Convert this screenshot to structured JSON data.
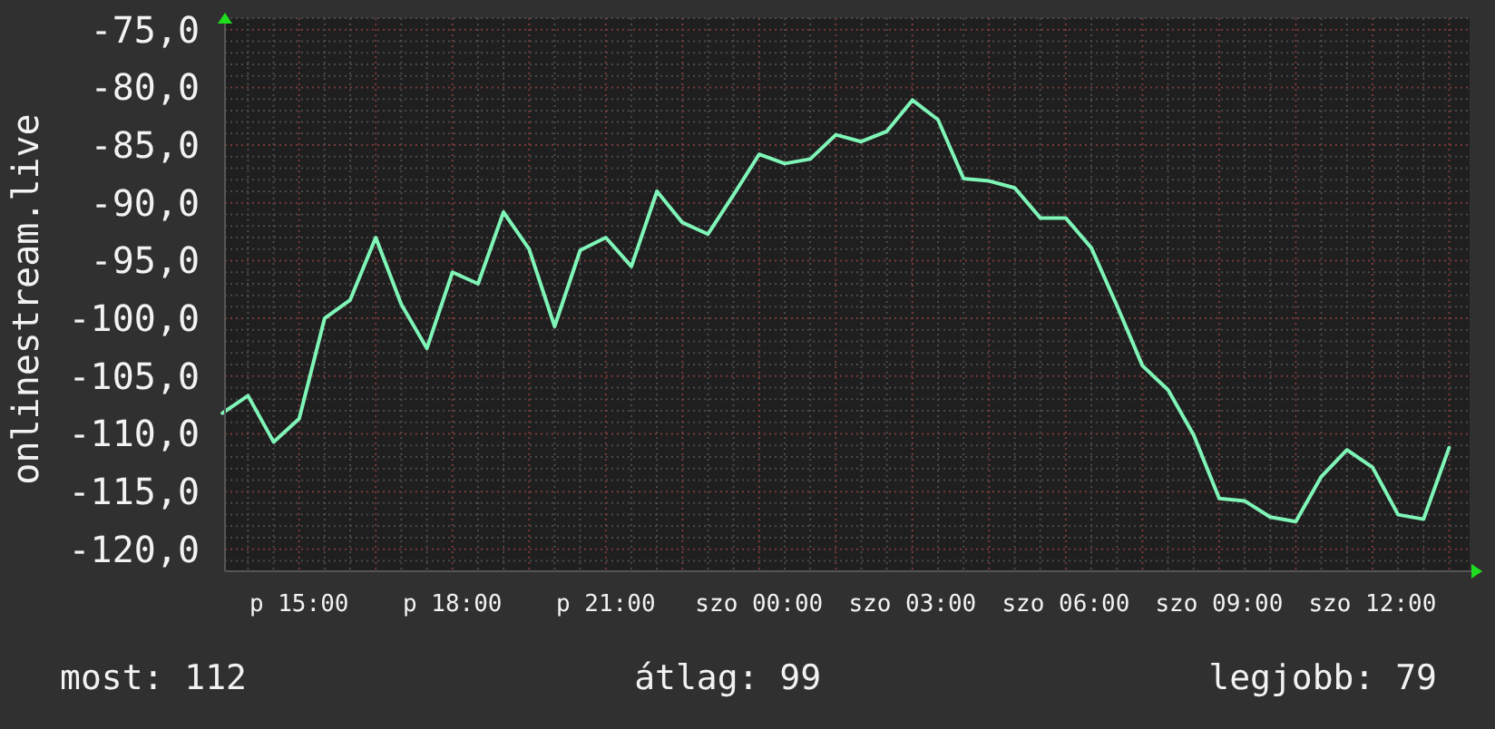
{
  "chart": {
    "chart_data": {
      "type": "line",
      "ylabel": "onlinestream.live",
      "categories": [
        null,
        null,
        null,
        "p 15:00",
        null,
        null,
        null,
        null,
        null,
        "p 18:00",
        null,
        null,
        null,
        null,
        null,
        "p 21:00",
        null,
        null,
        null,
        null,
        null,
        "szo 00:00",
        null,
        null,
        null,
        null,
        null,
        "szo 03:00",
        null,
        null,
        null,
        null,
        null,
        "szo 06:00",
        null,
        null,
        null,
        null,
        null,
        "szo 09:00",
        null,
        null,
        null,
        null,
        null,
        "szo 12:00",
        null,
        null,
        null
      ],
      "series": [
        {
          "color": "#7ff5b8",
          "values": [
            -108.2,
            -106.7,
            -110.7,
            -108.7,
            -100.0,
            -98.4,
            -93.0,
            -98.8,
            -102.6,
            -96.0,
            -97.0,
            -90.8,
            -94.0,
            -100.7,
            -94.1,
            -93.0,
            -95.5,
            -89.0,
            -91.7,
            -92.7,
            -89.3,
            -85.8,
            -86.6,
            -86.2,
            -84.1,
            -84.7,
            -83.8,
            -81.1,
            -82.8,
            -87.9,
            -88.1,
            -88.7,
            -91.3,
            -91.3,
            -93.9,
            -98.9,
            -104.1,
            -106.2,
            -110.1,
            -115.6,
            -115.8,
            -117.2,
            -117.6,
            -113.7,
            -111.4,
            -112.9,
            -117.0,
            -117.4,
            -111.2
          ]
        }
      ],
      "grid": true,
      "ylim": [
        -121.9,
        -74.0
      ],
      "yticks": [
        {
          "value": -75,
          "label": "-75,0"
        },
        {
          "value": -80,
          "label": "-80,0"
        },
        {
          "value": -85,
          "label": "-85,0"
        },
        {
          "value": -90,
          "label": "-90,0"
        },
        {
          "value": -95,
          "label": "-95,0"
        },
        {
          "value": -100,
          "label": "-100,0"
        },
        {
          "value": -105,
          "label": "-105,0"
        },
        {
          "value": -110,
          "label": "-110,0"
        },
        {
          "value": -115,
          "label": "-115,0"
        },
        {
          "value": -120,
          "label": "-120,0"
        }
      ]
    }
  },
  "summary": [
    "most: 112",
    "átlag: 99",
    "legjobb: 79"
  ]
}
